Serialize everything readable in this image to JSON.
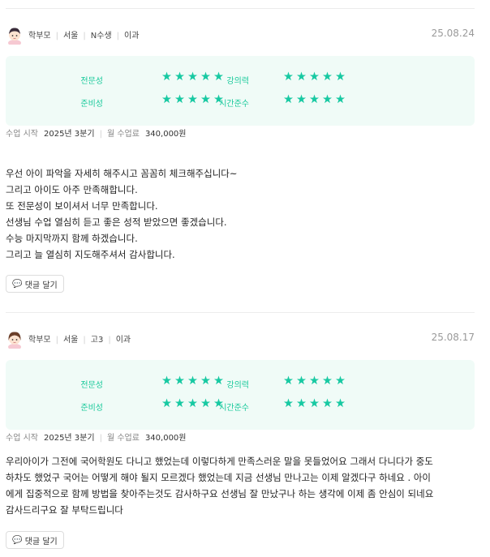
{
  "reviews": [
    {
      "role": "학부모",
      "region": "서울",
      "grade": "N수생",
      "track": "이과",
      "date": "25.08.24",
      "ratings": [
        {
          "label": "전문성",
          "score": 5,
          "stars": "★★★★★"
        },
        {
          "label": "강의력",
          "score": 5,
          "stars": "★★★★★"
        },
        {
          "label": "준비성",
          "score": 5,
          "stars": "★★★★★"
        },
        {
          "label": "시간준수",
          "score": 5,
          "stars": "★★★★★"
        }
      ],
      "start_label": "수업 시작",
      "start_value": "2025년 3분기",
      "fee_label": "월 수업료",
      "fee_value": "340,000원",
      "text": "우선 아이 파악을 자세히 해주시고 꼼꼼히 체크해주십니다~\n그리고 아이도 아주 만족해합니다.\n또 전문성이 보이셔서 너무 만족합니다.\n선생님 수업 열심히 듣고 좋은 성적 받았으면 좋겠습니다.\n수능 마지막까지 함께 하겠습니다.\n그리고 늘 열심히 지도해주셔서 감사합니다.",
      "reply_label": "댓글 달기"
    },
    {
      "role": "학부모",
      "region": "서울",
      "grade": "고3",
      "track": "이과",
      "date": "25.08.17",
      "ratings": [
        {
          "label": "전문성",
          "score": 5,
          "stars": "★★★★★"
        },
        {
          "label": "강의력",
          "score": 5,
          "stars": "★★★★★"
        },
        {
          "label": "준비성",
          "score": 5,
          "stars": "★★★★★"
        },
        {
          "label": "시간준수",
          "score": 5,
          "stars": "★★★★★"
        }
      ],
      "start_label": "수업 시작",
      "start_value": "2025년 3분기",
      "fee_label": "월 수업료",
      "fee_value": "340,000원",
      "text": "우리아이가 그전에 국어학원도 다니고 했었는데 이렇다하게 만족스러운 말을 못들었어요 그래서 다니다가 중도\n하차도 했었구 국어는 어떻게 해야 될지 모르겠다 했었는데 지금 선생님 만나고는 이제 알겠다구 하네요 . 아이\n에게 집중적으로 함께 방법을 찾아주는것도 감사하구요 선생님 잘 만났구나 하는 생각에 이제 좀 안심이 되네요\n감사드리구요 잘 부탁드립니다",
      "reply_label": "댓글 달기"
    }
  ],
  "colors": {
    "accent": "#17c9a2",
    "rating_bg": "#f0fbf7"
  },
  "icons": {
    "reply": "comment-icon",
    "avatar": "parent-avatar-icon"
  }
}
